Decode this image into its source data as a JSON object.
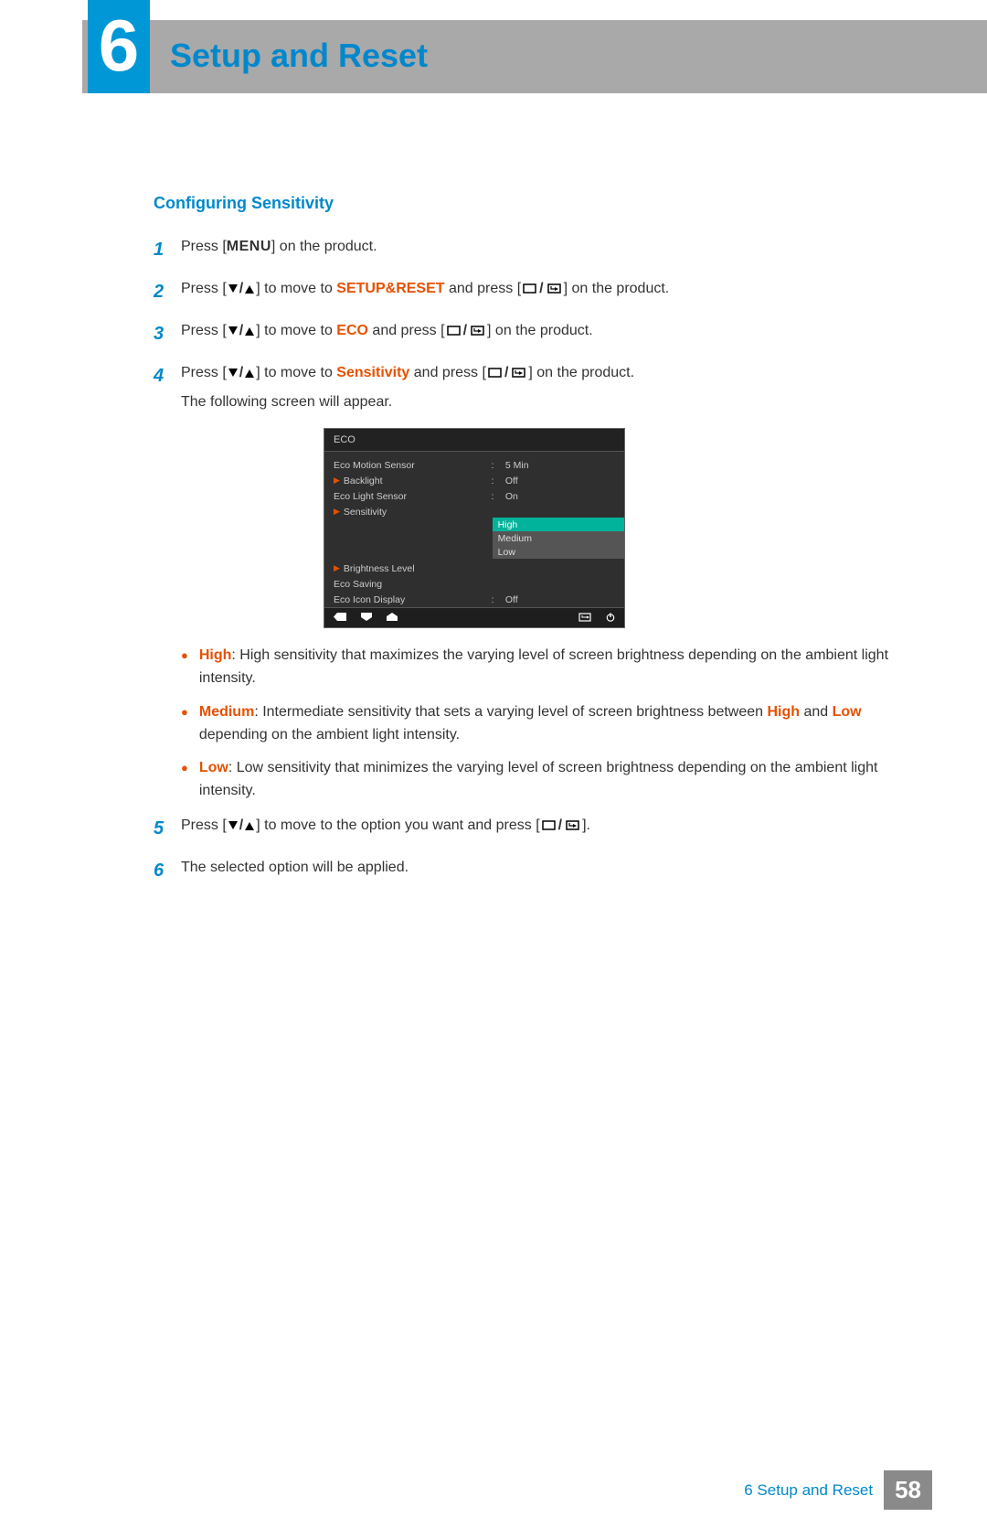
{
  "chapter_number": "6",
  "header": {
    "title": "Setup and Reset"
  },
  "section_title": "Configuring Sensitivity",
  "labels": {
    "menu_button": "MENU"
  },
  "steps": {
    "s1": {
      "num": "1",
      "pre": "Press [",
      "post": "] on the product."
    },
    "s2": {
      "num": "2",
      "pre": "Press [",
      "mid1": "] to move to ",
      "kw": "SETUP&RESET",
      "mid2": " and press [",
      "post": "] on the product."
    },
    "s3": {
      "num": "3",
      "pre": "Press [",
      "mid1": "] to move to ",
      "kw": "ECO",
      "mid2": " and press [",
      "post": "] on the product."
    },
    "s4": {
      "num": "4",
      "pre": "Press [",
      "mid1": "] to move to ",
      "kw": "Sensitivity",
      "mid2": " and press [",
      "post": "] on the product.",
      "sub": "The following screen will appear."
    },
    "s5": {
      "num": "5",
      "pre": "Press [",
      "mid1": "] to move to the option you want and press [",
      "post": "]."
    },
    "s6": {
      "num": "6",
      "text": "The selected option will be applied."
    }
  },
  "osd": {
    "title": "ECO",
    "rows": [
      {
        "label": "Eco Motion Sensor",
        "value": "5 Min",
        "indent": false
      },
      {
        "label": "Backlight",
        "value": "Off",
        "indent": true
      },
      {
        "label": "Eco Light Sensor",
        "value": "On",
        "indent": false
      },
      {
        "label": "Sensitivity",
        "value": "",
        "indent": true
      },
      {
        "label": "Brightness Level",
        "value": "",
        "indent": true
      },
      {
        "label": "Eco Saving",
        "value": "",
        "indent": false
      },
      {
        "label": "Eco Icon Display",
        "value": "Off",
        "indent": false
      }
    ],
    "dropdown": {
      "options": [
        "High",
        "Medium",
        "Low"
      ],
      "selected": "High"
    }
  },
  "bullets": [
    {
      "kw": "High",
      "rest": ": High sensitivity that maximizes the varying level of screen brightness depending on the ambient light intensity."
    },
    {
      "kw": "Medium",
      "rest_a": ": Intermediate sensitivity that sets a varying level of screen brightness between ",
      "hl1": "High",
      "mid": " and ",
      "hl2": "Low",
      "rest_b": " depending on the ambient light intensity."
    },
    {
      "kw": "Low",
      "rest": ": Low sensitivity that minimizes the varying level of screen brightness depending on the ambient light intensity."
    }
  ],
  "footer": {
    "text": "6 Setup and Reset",
    "page": "58"
  }
}
